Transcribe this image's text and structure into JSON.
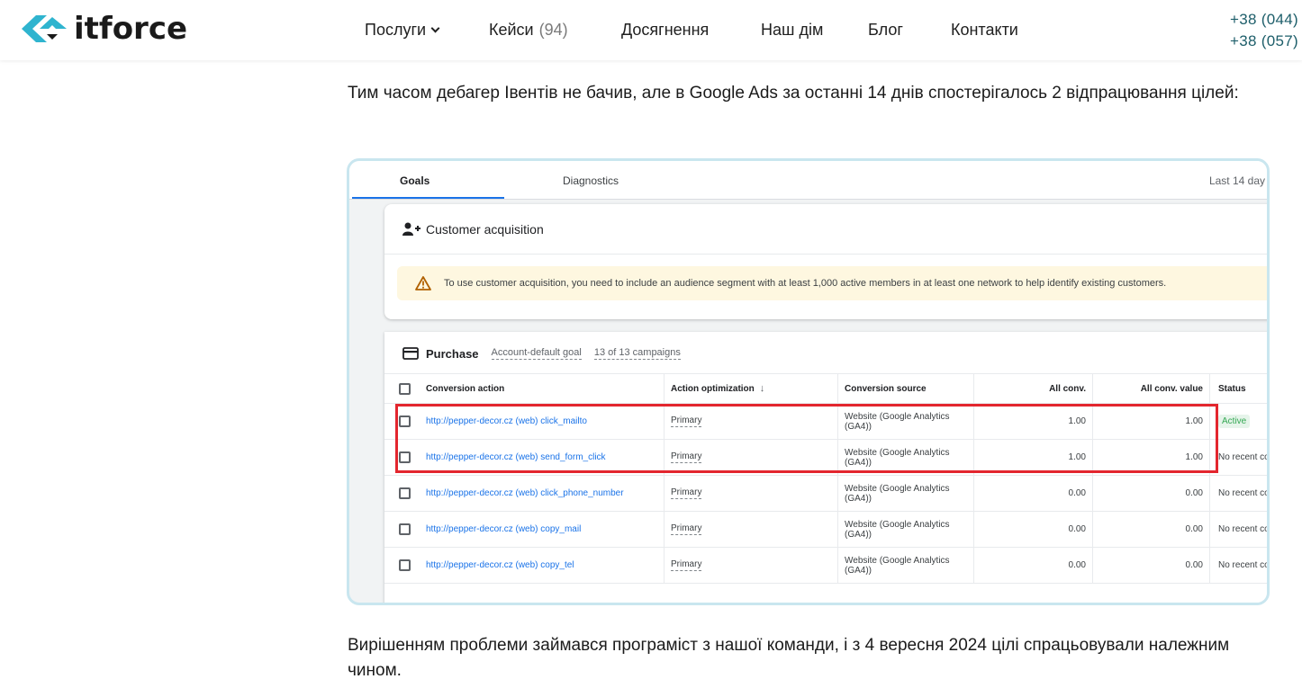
{
  "header": {
    "logo_text": "itforce",
    "nav": [
      {
        "label": "Послуги",
        "has_dropdown": true
      },
      {
        "label": "Кейси",
        "count": "(94)"
      },
      {
        "label": "Досягнення"
      },
      {
        "label": "Наш дім"
      },
      {
        "label": "Блог"
      },
      {
        "label": "Контакти"
      }
    ],
    "phones": [
      "+38 (044)",
      "+38 (057)"
    ],
    "colors": {
      "logo_accent": "#2fb4cf",
      "phone": "#1d5e6a"
    }
  },
  "article": {
    "para1": "Тим часом дебагер Івентів не бачив, але в Google Ads за останні 14 днів спостерігалось 2 відпрацювання цілей:",
    "para2": "Вирішенням проблеми займався програміст з нашої команди, і з 4 вересня 2024 цілі спрацьовували належним чином."
  },
  "screenshot": {
    "tabs": {
      "goals": "Goals",
      "diagnostics": "Diagnostics",
      "range": "Last 14 day"
    },
    "customer_card": {
      "title": "Customer acquisition",
      "warning": "To use customer acquisition, you need to include an audience segment with at least 1,000 active members in at least one network to help identify existing customers."
    },
    "purchase_card": {
      "title": "Purchase",
      "default_goal": "Account-default goal",
      "campaigns": "13 of 13 campaigns",
      "columns": {
        "action": "Conversion action",
        "optimization": "Action optimization",
        "source": "Conversion source",
        "all_conv": "All conv.",
        "all_conv_value": "All conv. value",
        "status": "Status"
      },
      "rows": [
        {
          "action": "http://pepper-decor.cz (web) click_mailto",
          "optimization": "Primary",
          "source": "Website (Google Analytics (GA4))",
          "all_conv": "1.00",
          "all_conv_value": "1.00",
          "status": "Active"
        },
        {
          "action": "http://pepper-decor.cz (web) send_form_click",
          "optimization": "Primary",
          "source": "Website (Google Analytics (GA4))",
          "all_conv": "1.00",
          "all_conv_value": "1.00",
          "status": "No recent co"
        },
        {
          "action": "http://pepper-decor.cz (web) click_phone_number",
          "optimization": "Primary",
          "source": "Website (Google Analytics (GA4))",
          "all_conv": "0.00",
          "all_conv_value": "0.00",
          "status": "No recent co"
        },
        {
          "action": "http://pepper-decor.cz (web) copy_mail",
          "optimization": "Primary",
          "source": "Website (Google Analytics (GA4))",
          "all_conv": "0.00",
          "all_conv_value": "0.00",
          "status": "No recent co"
        },
        {
          "action": "http://pepper-decor.cz (web) copy_tel",
          "optimization": "Primary",
          "source": "Website (Google Analytics (GA4))",
          "all_conv": "0.00",
          "all_conv_value": "0.00",
          "status": "No recent co"
        }
      ]
    },
    "colors": {
      "highlight": "#e3262e",
      "link": "#1a73e8",
      "active": "#34a853"
    }
  }
}
